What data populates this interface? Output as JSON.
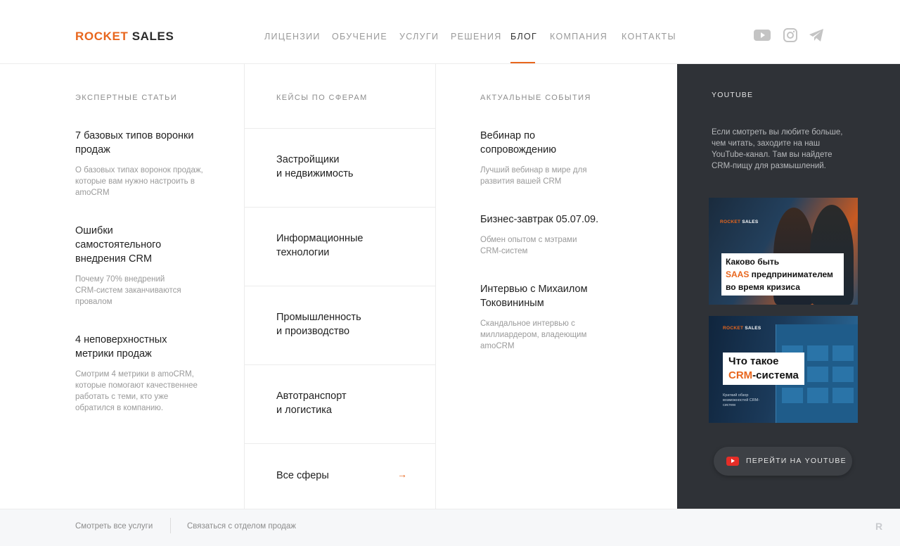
{
  "header": {
    "logo": {
      "part1": "ROCKET",
      "part2": "SALES"
    },
    "nav": [
      {
        "label": "ЛИЦЕНЗИИ"
      },
      {
        "label": "ОБУЧЕНИЕ"
      },
      {
        "label": "УСЛУГИ"
      },
      {
        "label": "РЕШЕНИЯ"
      },
      {
        "label": "БЛОГ",
        "active": true
      },
      {
        "label": "КОМПАНИЯ"
      },
      {
        "label": "КОНТАКТЫ"
      }
    ],
    "social": [
      "youtube-icon",
      "instagram-icon",
      "telegram-icon"
    ]
  },
  "expert": {
    "title": "ЭКСПЕРТНЫЕ СТАТЬИ",
    "items": [
      {
        "title": "7 базовых типов воронки продаж",
        "desc": "О базовых типах воронок продаж, которые вам нужно настроить в amoCRM"
      },
      {
        "title": "Ошибки самостоятельного внедрения CRM",
        "desc": "Почему 70% внедрений CRM-систем заканчиваются провалом"
      },
      {
        "title": "4 неповерхностных метрики продаж",
        "desc": "Смотрим 4 метрики в amoCRM, которые помогают качественнее работать с теми, кто уже обратился в компанию."
      }
    ]
  },
  "cases": {
    "title": "КЕЙСЫ ПО СФЕРАМ",
    "items": [
      {
        "line1": "Застройщики",
        "line2": "и недвижимость"
      },
      {
        "line1": "Информационные",
        "line2": "технологии"
      },
      {
        "line1": "Промышленность",
        "line2": "и производство"
      },
      {
        "line1": "Автотранспорт",
        "line2": "и логистика"
      }
    ],
    "all_label": "Все сферы",
    "all_arrow": "→"
  },
  "events": {
    "title": "АКТУАЛЬНЫЕ СОБЫТИЯ",
    "items": [
      {
        "title": "Вебинар по сопровождению",
        "desc": "Лучший вебинар в мире для развития вашей CRM"
      },
      {
        "title": "Бизнес-завтрак 05.07.09.",
        "desc": "Обмен опытом с мэтрами CRM-систем"
      },
      {
        "title": "Интервью с Михаилом Токовининым",
        "desc": "Скандальное интервью с миллиардером, владеющим amoCRM"
      }
    ]
  },
  "youtube": {
    "title": "YOUTUBE",
    "desc": "Если смотреть вы любите больше, чем читать, заходите на наш YouTube-канал. Там вы найдете CRM-пищу для размышлений.",
    "video1": {
      "brand1": "ROCKET",
      "brand2": "SALES",
      "line1": "Каково быть",
      "line2_accent": "SAAS",
      "line2_rest": " предпринимателем",
      "line3": "во время кризиса"
    },
    "video2": {
      "brand1": "ROCKET",
      "brand2": "SALES",
      "line1": "Что такое",
      "line2_accent": "CRM",
      "line2_rest": "-система",
      "small": "Краткий обзор возможностей CRM-систем"
    },
    "button_label": "ПЕРЕЙТИ НА YOUTUBE"
  },
  "footer": {
    "link1": "Смотреть все услуги",
    "link2": "Связаться с отделом продаж",
    "mark": "R"
  },
  "colors": {
    "accent": "#e8661d",
    "dark_panel": "#2f3237",
    "footer_bg": "#f6f7f9"
  }
}
